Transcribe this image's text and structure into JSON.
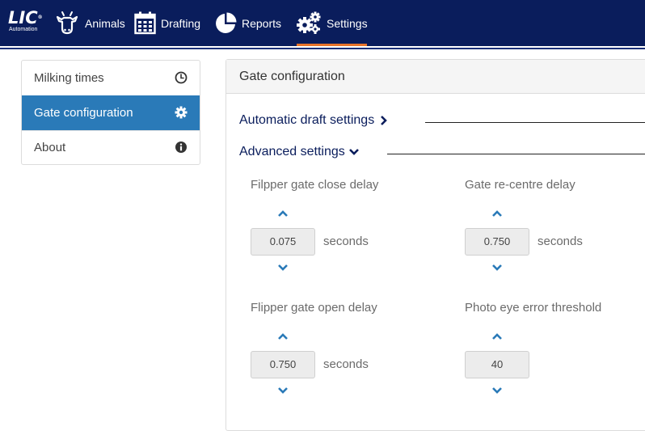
{
  "app": {
    "logo_main": "LIC",
    "logo_tm": "®",
    "logo_sub": "Automation"
  },
  "nav": {
    "items": [
      {
        "label": "Animals",
        "icon": "cow-icon"
      },
      {
        "label": "Drafting",
        "icon": "calendar-icon"
      },
      {
        "label": "Reports",
        "icon": "pie-chart-icon"
      },
      {
        "label": "Settings",
        "icon": "gears-icon",
        "active": true
      }
    ]
  },
  "sidebar": {
    "items": [
      {
        "label": "Milking times",
        "icon": "clock-icon"
      },
      {
        "label": "Gate configuration",
        "icon": "gear-icon",
        "active": true
      },
      {
        "label": "About",
        "icon": "info-icon"
      }
    ]
  },
  "panel": {
    "title": "Gate configuration",
    "automatic_section": "Automatic draft settings",
    "advanced_section": "Advanced settings",
    "fields": [
      {
        "label": "Filpper gate close delay",
        "value": "0.075",
        "unit": "seconds"
      },
      {
        "label": "Gate re-centre delay",
        "value": "0.750",
        "unit": "seconds"
      },
      {
        "label": "Flipper gate open delay",
        "value": "0.750",
        "unit": "seconds"
      },
      {
        "label": "Photo eye error threshold",
        "value": "40",
        "unit": ""
      }
    ]
  },
  "colors": {
    "topbar": "#0a1d5c",
    "accent": "#e8732a",
    "active_item": "#2a7ab8",
    "chevron": "#2a7ab8"
  }
}
